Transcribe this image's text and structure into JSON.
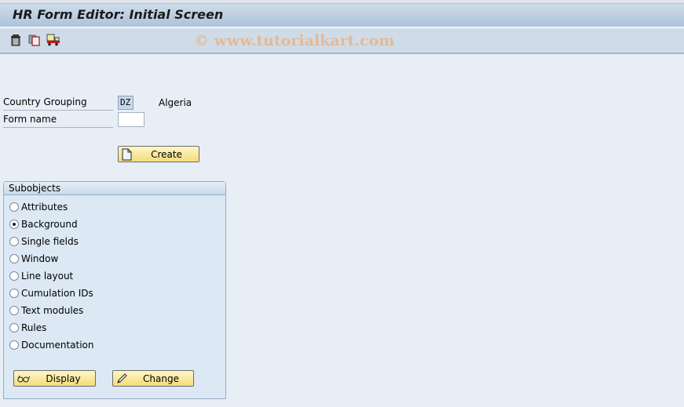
{
  "window": {
    "title": "HR Form Editor: Initial Screen"
  },
  "toolbar": {
    "items": [
      {
        "name": "delete",
        "icon": "trash-icon"
      },
      {
        "name": "copy",
        "icon": "copy-icon"
      },
      {
        "name": "transport",
        "icon": "truck-icon"
      }
    ],
    "watermark": "© www.tutorialkart.com"
  },
  "form": {
    "country_grouping_label": "Country Grouping",
    "country_grouping_value": "DZ",
    "country_grouping_text": "Algeria",
    "form_name_label": "Form name",
    "form_name_value": "",
    "create_button": "Create"
  },
  "subobjects": {
    "title": "Subobjects",
    "options": [
      {
        "label": "Attributes",
        "checked": false
      },
      {
        "label": "Background",
        "checked": true
      },
      {
        "label": "Single fields",
        "checked": false
      },
      {
        "label": "Window",
        "checked": false
      },
      {
        "label": "Line layout",
        "checked": false
      },
      {
        "label": "Cumulation IDs",
        "checked": false
      },
      {
        "label": "Text modules",
        "checked": false
      },
      {
        "label": "Rules",
        "checked": false
      },
      {
        "label": "Documentation",
        "checked": false
      }
    ],
    "display_button": "Display",
    "change_button": "Change"
  }
}
